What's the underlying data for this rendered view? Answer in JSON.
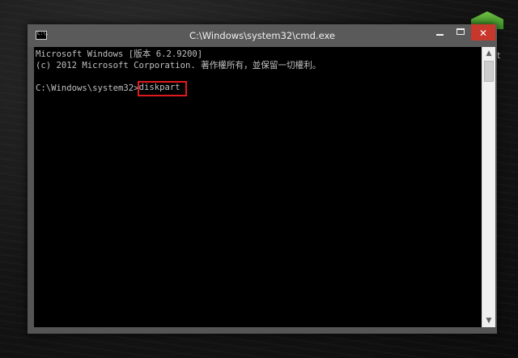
{
  "window": {
    "title": "C:\\Windows\\system32\\cmd.exe",
    "icon_text": "C:\\.",
    "controls": {
      "minimize_icon": "minimize-icon",
      "maximize_icon": "maximize-icon",
      "close_icon": "close-icon",
      "close_symbol": "✕"
    },
    "close_color": "#c7372b"
  },
  "console": {
    "lines": [
      "Microsoft Windows [版本 6.2.9200]",
      "(c) 2012 Microsoft Corporation. 著作權所有，並保留一切權利。"
    ],
    "prompt": "C:\\Windows\\system32>",
    "command": "diskpart",
    "text_color": "#c0c0c0",
    "background": "#000000",
    "highlight_color": "#e0191e"
  },
  "scrollbar": {
    "up_arrow": "▲",
    "down_arrow": "▼"
  },
  "desktop": {
    "peek_label": "t"
  }
}
